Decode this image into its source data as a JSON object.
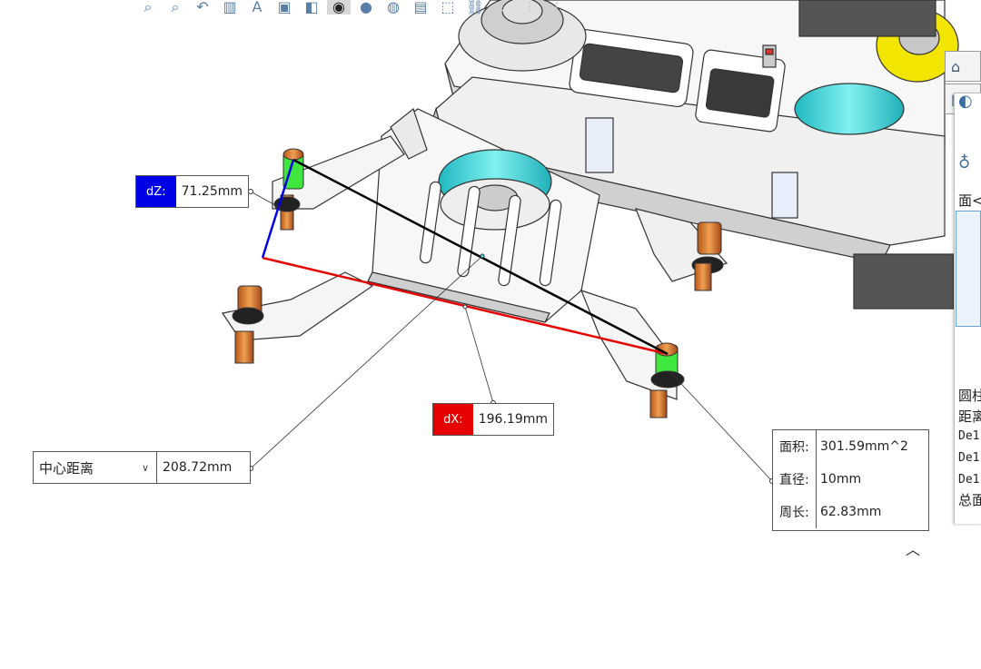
{
  "measure": {
    "dz": {
      "label": "dZ:",
      "value": "71.25mm"
    },
    "dx": {
      "label": "dX:",
      "value": "196.19mm"
    },
    "center": {
      "mode": "中心距离",
      "value": "208.72mm"
    },
    "face": {
      "area_label": "面积:",
      "area_value": "301.59mm^2",
      "diameter_label": "直径:",
      "diameter_value": "10mm",
      "perimeter_label": "周长:",
      "perimeter_value": "62.83mm"
    }
  },
  "side_panel": {
    "rows": [
      "面<",
      "面<",
      "圆柱",
      "距离",
      "De1",
      "De1",
      "De1",
      "总面"
    ]
  },
  "toolbar": {
    "icons": [
      "zoom-to-fit-icon",
      "zoom-area-icon",
      "previous-view-icon",
      "section-view-icon",
      "dynamic-annotation-icon",
      "view-orientation-icon",
      "display-style-icon",
      "hide-show-icon",
      "edit-appearance-icon",
      "apply-scene-icon",
      "view-settings-icon",
      "screen-capture-icon",
      "link-icon",
      "faded-icon-1",
      "faded-icon-2",
      "faded-icon-3"
    ]
  },
  "colors": {
    "dz": "#0000e6",
    "dx": "#e60000",
    "center": "#000000",
    "highlight": "#00e600"
  }
}
